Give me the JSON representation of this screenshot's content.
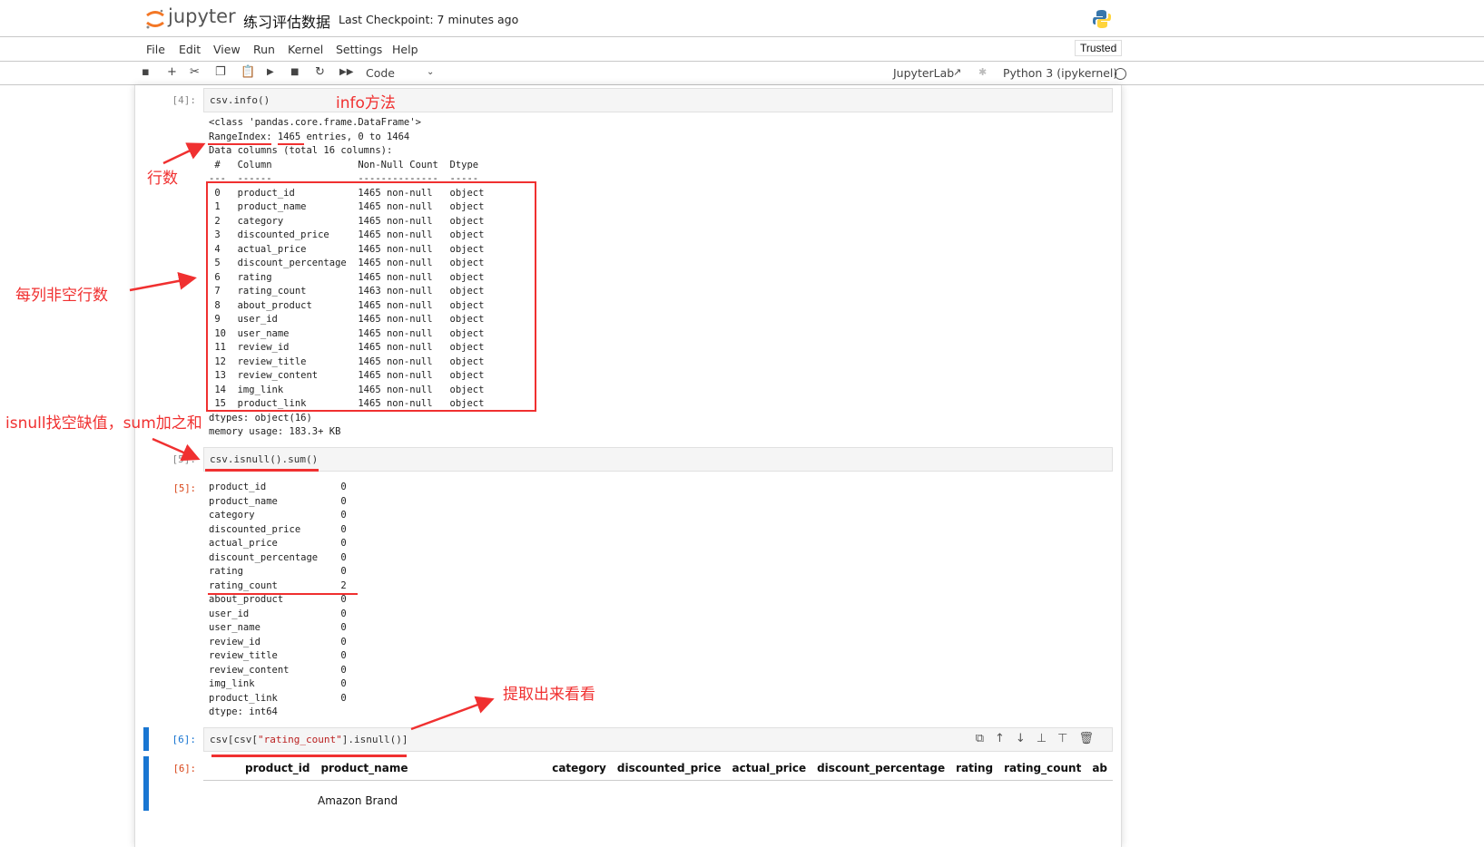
{
  "header": {
    "logo": "jupyter",
    "notebook_title": "练习评估数据",
    "checkpoint": "Last Checkpoint: 7 minutes ago",
    "trusted": "Trusted"
  },
  "menu": [
    "File",
    "Edit",
    "View",
    "Run",
    "Kernel",
    "Settings",
    "Help"
  ],
  "toolbar": {
    "cell_type": "Code",
    "jupyterlab": "JupyterLab",
    "kernel": "Python 3 (ipykernel)"
  },
  "cells": [
    {
      "prompt": "[4]:",
      "code": "csv.info()",
      "output": "<class 'pandas.core.frame.DataFrame'>\nRangeIndex: 1465 entries, 0 to 1464\nData columns (total 16 columns):\n #   Column               Non-Null Count  Dtype \n---  ------               --------------  ----- \n 0   product_id           1465 non-null   object\n 1   product_name         1465 non-null   object\n 2   category             1465 non-null   object\n 3   discounted_price     1465 non-null   object\n 4   actual_price         1465 non-null   object\n 5   discount_percentage  1465 non-null   object\n 6   rating               1465 non-null   object\n 7   rating_count         1463 non-null   object\n 8   about_product        1465 non-null   object\n 9   user_id              1465 non-null   object\n 10  user_name            1465 non-null   object\n 11  review_id            1465 non-null   object\n 12  review_title         1465 non-null   object\n 13  review_content       1465 non-null   object\n 14  img_link             1465 non-null   object\n 15  product_link         1465 non-null   object\ndtypes: object(16)\nmemory usage: 183.3+ KB"
    },
    {
      "prompt": "[5]:",
      "out_prompt": "[5]:",
      "code": "csv.isnull().sum()",
      "output": "product_id             0\nproduct_name           0\ncategory               0\ndiscounted_price       0\nactual_price           0\ndiscount_percentage    0\nrating                 0\nrating_count           2\nabout_product          0\nuser_id                0\nuser_name              0\nreview_id              0\nreview_title           0\nreview_content         0\nimg_link               0\nproduct_link           0\ndtype: int64"
    },
    {
      "prompt": "[6]:",
      "out_prompt": "[6]:",
      "code_pre": "csv[csv[",
      "code_str": "\"rating_count\"",
      "code_post": "].isnull()]",
      "columns": [
        "product_id",
        "product_name",
        "category",
        "discounted_price",
        "actual_price",
        "discount_percentage",
        "rating",
        "rating_count",
        "ab"
      ],
      "first_row_name": "Amazon Brand"
    }
  ],
  "annotations": {
    "info": "info方法",
    "rows": "行数",
    "nonnull": "每列非空行数",
    "isnull": "isnull找空缺值，sum加之和",
    "extract": "提取出来看看"
  },
  "colors": {
    "annotation": "#f03030",
    "selected_cell": "#1976d2"
  }
}
